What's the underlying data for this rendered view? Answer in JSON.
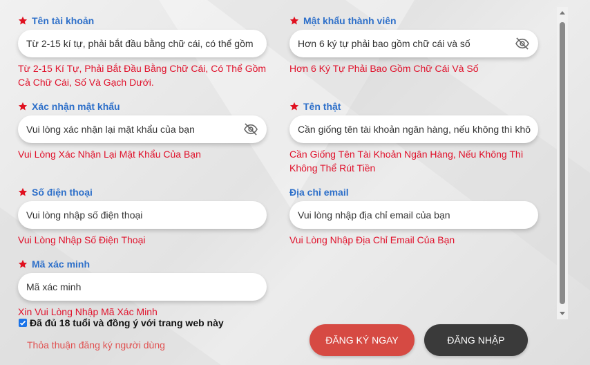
{
  "colors": {
    "label": "#2d6fc9",
    "error": "#e0102a",
    "required": "#e0101f",
    "primary_button": "#d64a43",
    "secondary_button": "#3a3a3a"
  },
  "fields": {
    "username": {
      "label": "Tên tài khoản",
      "required": true,
      "placeholder": "Từ 2-15 kí tự, phải bắt đầu bằng chữ cái, có thể  gồm",
      "error": "Từ 2-15 Kí Tự, Phải Bắt Đầu Bằng Chữ Cái, Có Thể Gồm Cả Chữ Cái, Số Và Gạch Dưới."
    },
    "password": {
      "label": "Mật khẩu thành viên",
      "required": true,
      "placeholder": "Hơn 6 ký tự phải bao gồm chữ cái và số",
      "icon": "eye-slash-icon",
      "error": "Hơn 6 Ký Tự Phải Bao Gồm Chữ Cái Và Số"
    },
    "confirm_password": {
      "label": "Xác nhận mật khẩu",
      "required": true,
      "placeholder": "Vui lòng xác nhận lại mật khẩu của bạn",
      "icon": "eye-slash-icon",
      "error": "Vui Lòng Xác Nhận Lại Mật Khẩu Của Bạn"
    },
    "real_name": {
      "label": "Tên thật",
      "required": true,
      "placeholder": "Cần giống tên tài khoản ngân hàng, nếu không thì khô",
      "error": "Cần Giống Tên Tài Khoản Ngân Hàng, Nếu Không Thì Không Thể Rút Tiền"
    },
    "phone": {
      "label": "Số điện thoại",
      "required": true,
      "placeholder": "Vui lòng nhập số điện thoại",
      "error": "Vui Lòng Nhập Số Điện Thoại"
    },
    "email": {
      "label": "Địa chỉ email",
      "required": false,
      "placeholder": "Vui lòng nhập địa chỉ email của bạn",
      "error": "Vui Lòng Nhập Địa Chỉ Email Của Bạn"
    },
    "captcha": {
      "label": "Mã xác minh",
      "required": true,
      "placeholder": "Mã xác minh",
      "error": "Xin Vui Lòng Nhập Mã Xác Minh"
    }
  },
  "agreement": {
    "checked": true,
    "label": "Đã đủ 18 tuổi và đồng ý với trang web này"
  },
  "terms_link": "Thỏa thuận đăng ký người dùng",
  "buttons": {
    "register": "ĐĂNG KÝ NGAY",
    "login": "ĐĂNG NHẬP"
  }
}
